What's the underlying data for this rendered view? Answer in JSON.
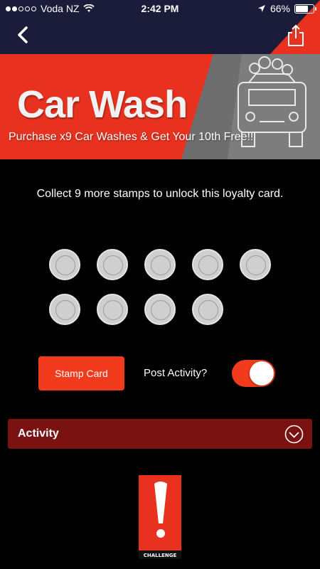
{
  "status_bar": {
    "carrier": "Voda NZ",
    "time": "2:42 PM",
    "battery": "66%",
    "battery_level": 0.66,
    "signal_bars_filled": 2,
    "signal_bars_total": 5
  },
  "nav": {
    "back_icon": "chevron-left-icon",
    "share_icon": "share-icon"
  },
  "banner": {
    "title": "Car Wash",
    "subtitle": "Purchase x9 Car Washes & Get Your 10th Free!!"
  },
  "loyalty": {
    "message": "Collect 9 more stamps to unlock this loyalty card.",
    "stamps_total": 9,
    "stamps_collected": 0
  },
  "actions": {
    "stamp_button": "Stamp Card",
    "post_activity_label": "Post Activity?",
    "post_activity_enabled": true
  },
  "activity": {
    "label": "Activity",
    "expand_icon": "chevron-down-circle-icon"
  },
  "footer": {
    "logo_text": "CHALLENGE"
  },
  "colors": {
    "accent": "#f23a1d",
    "nav_bg": "#1b1c3a",
    "activity_bg": "#7a1212",
    "background": "#000000"
  }
}
